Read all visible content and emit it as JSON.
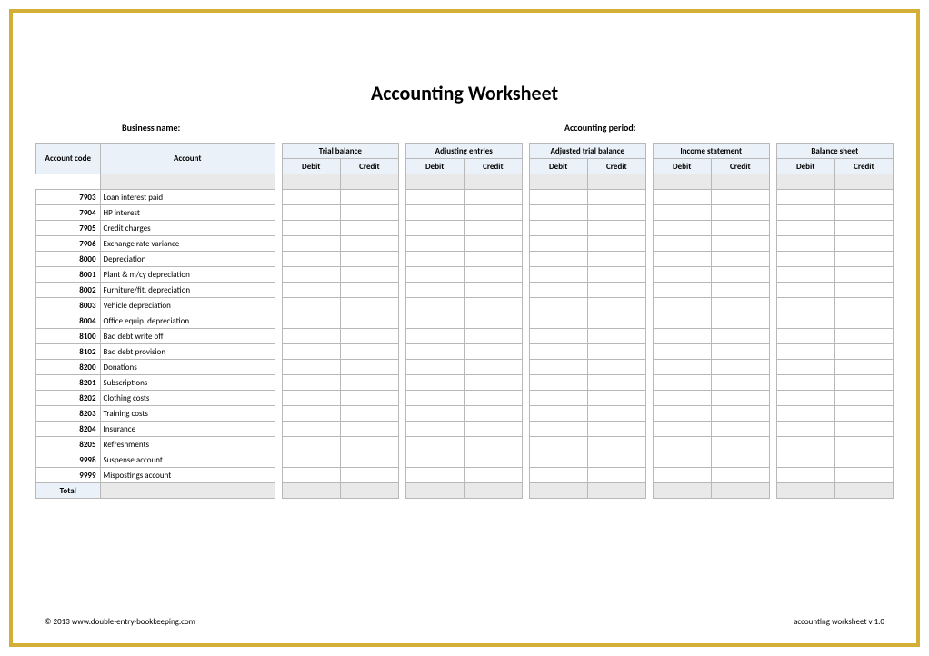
{
  "title": "Accounting Worksheet",
  "meta": {
    "business_label": "Business name:",
    "period_label": "Accounting period:"
  },
  "headers": {
    "account_code": "Account code",
    "account": "Account",
    "sections": [
      "Trial balance",
      "Adjusting entries",
      "Adjusted trial balance",
      "Income statement",
      "Balance sheet"
    ],
    "debit": "Debit",
    "credit": "Credit"
  },
  "rows": [
    {
      "code": "7903",
      "account": "Loan interest paid"
    },
    {
      "code": "7904",
      "account": "HP interest"
    },
    {
      "code": "7905",
      "account": "Credit charges"
    },
    {
      "code": "7906",
      "account": "Exchange rate variance"
    },
    {
      "code": "8000",
      "account": "Depreciation"
    },
    {
      "code": "8001",
      "account": "Plant & m/cy depreciation"
    },
    {
      "code": "8002",
      "account": "Furniture/fit. depreciation"
    },
    {
      "code": "8003",
      "account": "Vehicle depreciation"
    },
    {
      "code": "8004",
      "account": "Office equip. depreciation"
    },
    {
      "code": "8100",
      "account": "Bad debt write off"
    },
    {
      "code": "8102",
      "account": "Bad debt provision"
    },
    {
      "code": "8200",
      "account": "Donations"
    },
    {
      "code": "8201",
      "account": "Subscriptions"
    },
    {
      "code": "8202",
      "account": "Clothing costs"
    },
    {
      "code": "8203",
      "account": "Training costs"
    },
    {
      "code": "8204",
      "account": "Insurance"
    },
    {
      "code": "8205",
      "account": "Refreshments"
    },
    {
      "code": "9998",
      "account": "Suspense account"
    },
    {
      "code": "9999",
      "account": "Mispostings account"
    }
  ],
  "total_label": "Total",
  "footer": {
    "copyright": "© 2013 www.double-entry-bookkeeping.com",
    "version": "accounting worksheet v 1.0"
  }
}
